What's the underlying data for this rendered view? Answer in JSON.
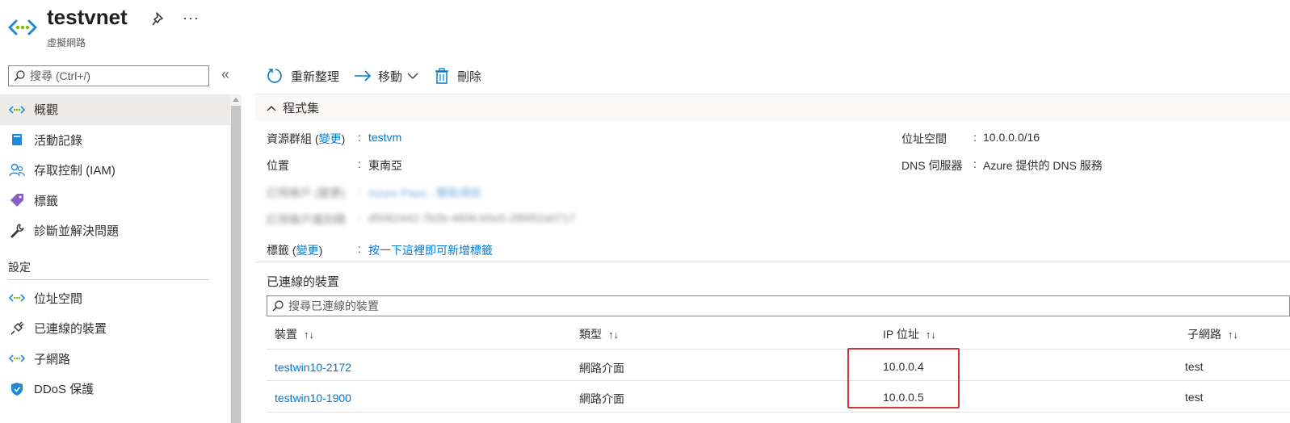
{
  "header": {
    "title": "testvnet",
    "subtitle": "虛擬網路",
    "more_label": "···"
  },
  "sidebar": {
    "search_placeholder": "搜尋 (Ctrl+/)",
    "collapse_label": "«",
    "items": [
      {
        "label": "概觀",
        "icon": "vnet-icon",
        "active": true
      },
      {
        "label": "活動記錄",
        "icon": "activity-log-icon"
      },
      {
        "label": "存取控制 (IAM)",
        "icon": "people-icon"
      },
      {
        "label": "標籤",
        "icon": "tag-icon"
      },
      {
        "label": "診斷並解決問題",
        "icon": "wrench-icon"
      }
    ],
    "section_label": "設定",
    "settings_items": [
      {
        "label": "位址空間",
        "icon": "vnet-icon"
      },
      {
        "label": "已連線的裝置",
        "icon": "plug-icon"
      },
      {
        "label": "子網路",
        "icon": "vnet-icon"
      },
      {
        "label": "DDoS 保護",
        "icon": "shield-icon"
      }
    ]
  },
  "toolbar": {
    "refresh_label": "重新整理",
    "move_label": "移動",
    "delete_label": "刪除"
  },
  "essentials": {
    "toggle_label": "程式集",
    "resource_group_label": "資源群組 (",
    "change_label": "變更",
    "close_paren": ")",
    "colon": ":",
    "resource_group_value": "testvm",
    "location_label": "位置",
    "location_value": "東南亞",
    "subscription_label": "訂用帳戶 (變更)",
    "subscription_value": "Azure Pass - 贊助項目",
    "subscription_id_label": "訂用帳戶識別碼",
    "subscription_id_value": "d5062442-7b2b-4808-b5e5-2f8952a0717",
    "tags_label": "標籤 (",
    "tags_value": "按一下這裡即可新增標籤",
    "address_space_label": "位址空間",
    "address_space_value": "10.0.0.0/16",
    "dns_label": "DNS 伺服器",
    "dns_value": "Azure 提供的 DNS 服務"
  },
  "connected_devices": {
    "title": "已連線的裝置",
    "search_placeholder": "搜尋已連線的裝置",
    "sort_glyph": "↑↓",
    "columns": [
      "裝置",
      "類型",
      "IP 位址",
      "子網路"
    ],
    "rows": [
      {
        "device": "testwin10-2172",
        "type": "網路介面",
        "ip": "10.0.0.4",
        "subnet": "test"
      },
      {
        "device": "testwin10-1900",
        "type": "網路介面",
        "ip": "10.0.0.5",
        "subnet": "test"
      }
    ]
  },
  "colors": {
    "accent": "#0078d4",
    "highlight": "#d13438"
  }
}
